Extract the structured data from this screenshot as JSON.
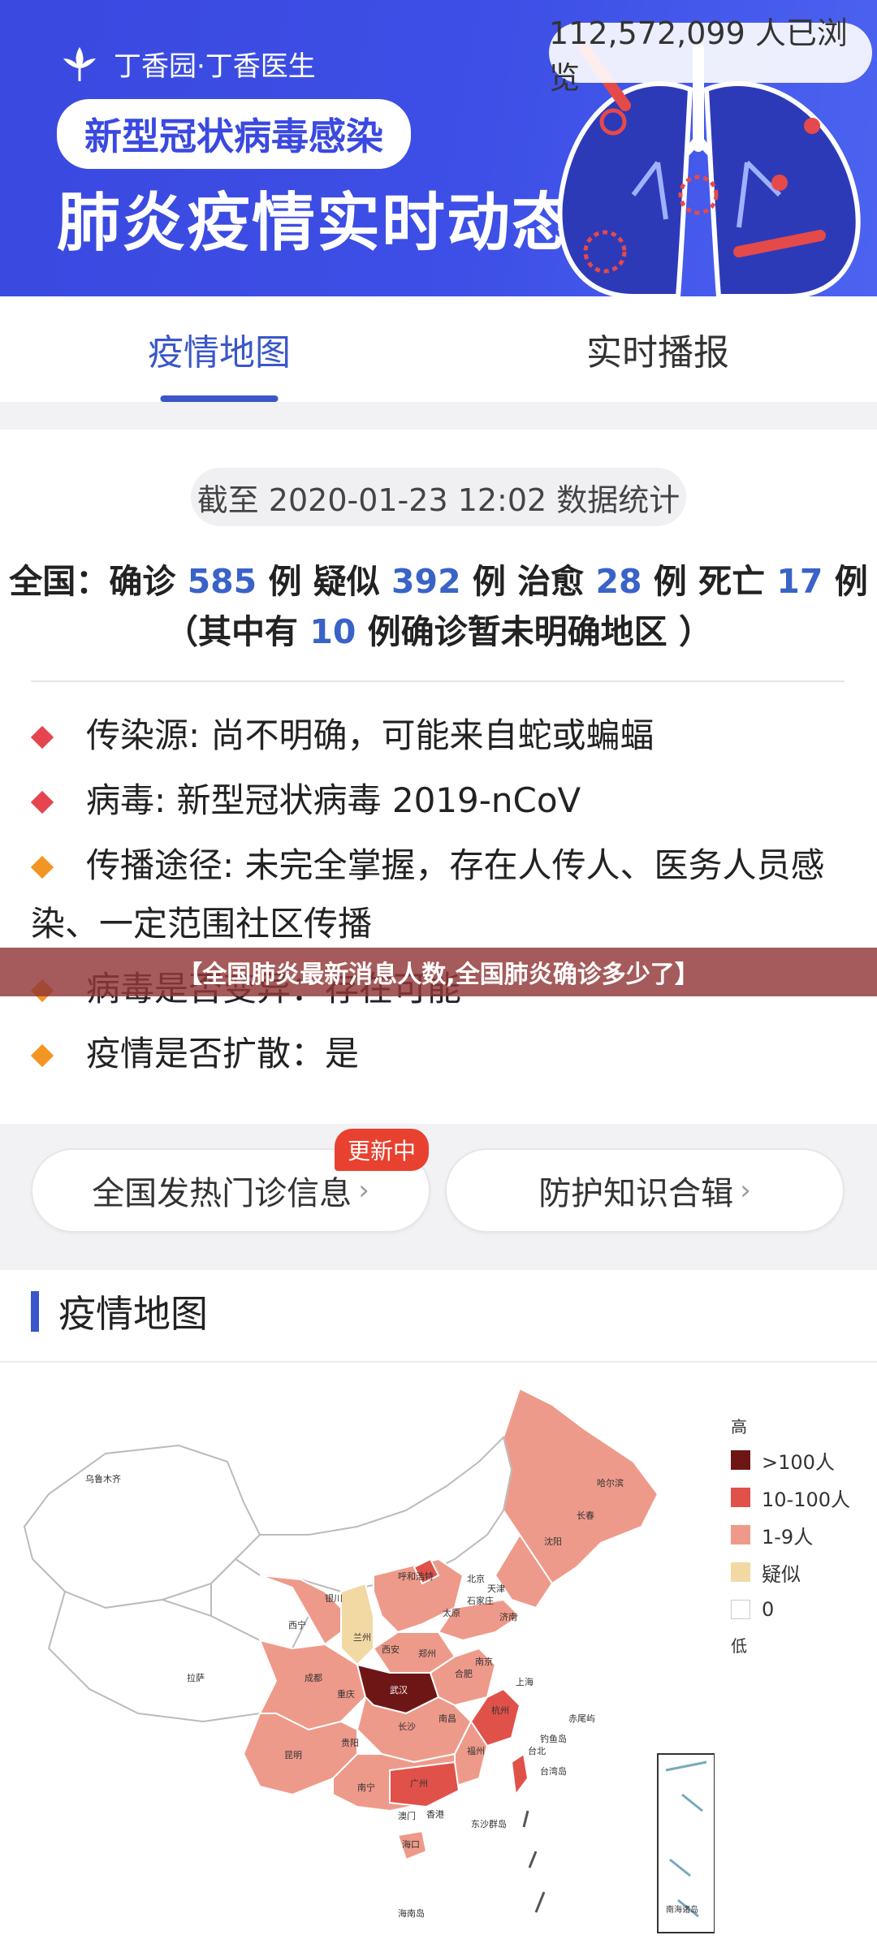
{
  "banner": {
    "brand": "丁香园·丁香医生",
    "subtitle": "新型冠状病毒感染",
    "headline": "肺炎疫情实时动态",
    "view_count": "112,572,099 人已浏览"
  },
  "tabs": [
    {
      "label": "疫情地图",
      "active": true
    },
    {
      "label": "实时播报",
      "active": false
    }
  ],
  "stats": {
    "date_label": "截至 2020-01-23 12:02 数据统计",
    "prefix": "全国：",
    "confirmed_label": "确诊",
    "confirmed": "585",
    "suspected_label": "疑似",
    "suspected": "392",
    "cured_label": "治愈",
    "cured": "28",
    "dead_label": "死亡",
    "dead": "17",
    "unit": "例",
    "unclear_prefix": "（其中有",
    "unclear": "10",
    "unclear_suffix": "例确诊暂未明确地区 ）"
  },
  "facts": [
    {
      "text": "传染源: 尚不明确，可能来自蛇或蝙蝠",
      "color": "#e5454f"
    },
    {
      "text": "病毒: 新型冠状病毒 2019-nCoV",
      "color": "#e5454f"
    },
    {
      "text": "传播途径: 未完全掌握，存在人传人、医务人员感染、一定范围社区传播",
      "color": "#f39523"
    },
    {
      "text": "病毒是否变异：存在可能",
      "color": "#f39523"
    },
    {
      "text": "疫情是否扩散：是",
      "color": "#f39523"
    }
  ],
  "overlay_caption": "【全国肺炎最新消息人数,全国肺炎确诊多少了】",
  "buttons": {
    "fever_clinic": "全国发热门诊信息",
    "protection": "防护知识合辑",
    "badge": "更新中"
  },
  "map_section": {
    "title": "疫情地图",
    "legend_high": "高",
    "legend_low": "低",
    "legend": [
      {
        "label": ">100人",
        "color": "#6e1616"
      },
      {
        "label": "10-100人",
        "color": "#e0514a"
      },
      {
        "label": "1-9人",
        "color": "#ee9a8a"
      },
      {
        "label": "疑似",
        "color": "#f2d9a4"
      },
      {
        "label": "0",
        "color": "#ffffff"
      }
    ],
    "city_labels": [
      "乌鲁木齐",
      "拉萨",
      "西宁",
      "兰州",
      "呼和浩特",
      "北京",
      "天津",
      "石家庄",
      "太原",
      "济南",
      "郑州",
      "西安",
      "成都",
      "重庆",
      "武汉",
      "合肥",
      "南京",
      "上海",
      "杭州",
      "长沙",
      "南昌",
      "福州",
      "贵阳",
      "昆明",
      "南宁",
      "广州",
      "香港",
      "澳门",
      "台北",
      "海口",
      "哈尔滨",
      "长春",
      "沈阳",
      "银川",
      "海南岛",
      "钓鱼岛",
      "东沙群岛",
      "南海诸岛",
      "台湾岛",
      "赤尾屿"
    ]
  }
}
